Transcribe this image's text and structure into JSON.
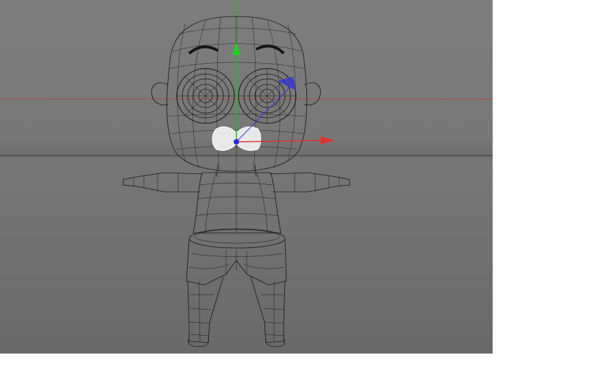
{
  "viewport": {
    "background_color": "#787878",
    "wire_color": "#111111"
  },
  "axes": {
    "x_color": "#e02020",
    "y_color": "#19c019",
    "z_color": "#3030e0",
    "selection_color": "#e8e8e8"
  }
}
